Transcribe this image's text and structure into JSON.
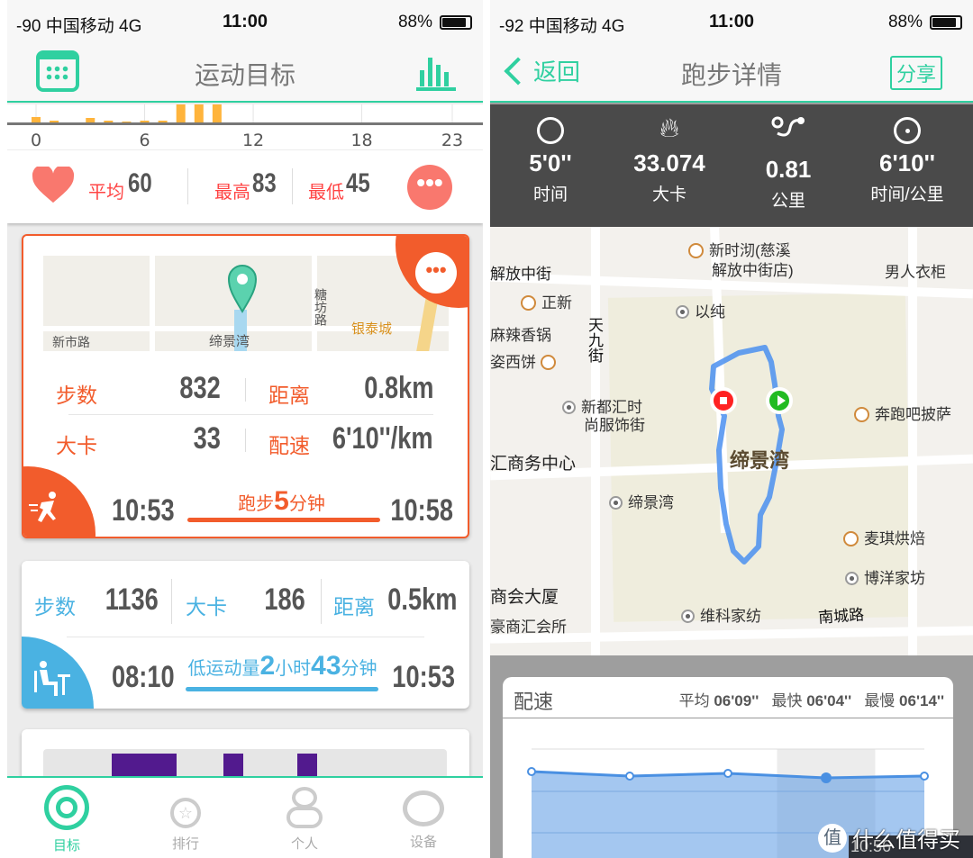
{
  "left": {
    "status": {
      "carrier": "-90 中国移动   4G",
      "time": "11:00",
      "battery": "88%",
      "battery_level": 0.88
    },
    "header": {
      "title": "运动目标",
      "left_icon": "calendar-icon",
      "right_icon": "bar-chart-icon"
    },
    "hourly_chart": {
      "type": "bar",
      "x_ticks": [
        "0",
        "6",
        "12",
        "18",
        "23"
      ],
      "hours": [
        0,
        1,
        3,
        4,
        5,
        6,
        7,
        8,
        9,
        10
      ],
      "values": [
        6,
        2,
        5,
        2,
        1,
        2,
        2,
        20,
        20,
        20
      ],
      "bar_color": "#ffb43c"
    },
    "heart": {
      "avg_label": "平均",
      "avg": "60",
      "max_label": "最高",
      "max": "83",
      "min_label": "最低",
      "min": "45",
      "color": "#f9786e"
    },
    "run_card": {
      "map_labels": {
        "road1": "新市路",
        "road2": "糖坊路",
        "place": "缔景湾",
        "mall": "银泰城"
      },
      "steps_label": "步数",
      "steps": "832",
      "distance_label": "距离",
      "distance": "0.8km",
      "cal_label": "大卡",
      "cal": "33",
      "pace_label": "配速",
      "pace": "6'10''/km",
      "start": "10:53",
      "end": "10:58",
      "activity_prefix": "跑步",
      "activity_value": "5",
      "activity_unit": "分钟",
      "accent": "#f25c2c"
    },
    "sit_card": {
      "steps_label": "步数",
      "steps": "1136",
      "cal_label": "大卡",
      "cal": "186",
      "distance_label": "距离",
      "distance": "0.5km",
      "start": "08:10",
      "end": "10:53",
      "activity_prefix": "低运动量",
      "hours": "2",
      "hours_unit": "小时",
      "minutes": "43",
      "minutes_unit": "分钟",
      "accent": "#4ab2e2"
    },
    "tabs": [
      {
        "label": "目标",
        "icon": "target-icon",
        "active": true
      },
      {
        "label": "排行",
        "icon": "medal-icon",
        "active": false
      },
      {
        "label": "个人",
        "icon": "person-icon",
        "active": false
      },
      {
        "label": "设备",
        "icon": "device-icon",
        "active": false
      }
    ]
  },
  "right": {
    "status": {
      "carrier": "-92 中国移动   4G",
      "time": "11:00",
      "battery": "88%",
      "battery_level": 0.88
    },
    "header": {
      "back": "返回",
      "title": "跑步详情",
      "share": "分享"
    },
    "stats": [
      {
        "value": "5'0''",
        "label": "时间",
        "icon": "stopwatch-icon"
      },
      {
        "value": "33.074",
        "label": "大卡",
        "icon": "flame-icon"
      },
      {
        "value": "0.81",
        "label": "公里",
        "icon": "route-icon"
      },
      {
        "value": "6'10''",
        "label": "时间/公里",
        "icon": "speedometer-icon"
      }
    ],
    "map_labels": [
      "新时沏(慈溪",
      "解放中街店)",
      "解放中街",
      "男人衣柜",
      "正新",
      "以纯",
      "麻辣香锅",
      "姿西饼",
      "天九街",
      "新都汇时",
      "尚服饰街",
      "奔跑吧披萨",
      "汇商务中心",
      "缔景湾",
      "缔景湾",
      "麦琪烘焙",
      "博洋家坊",
      "商会大厦",
      "豪商汇会所",
      "维科家纺",
      "南城路"
    ],
    "pace_card": {
      "title": "配速",
      "avg_label": "平均",
      "avg": "06'09''",
      "fast_label": "最快",
      "fast": "06'04''",
      "slow_label": "最慢",
      "slow": "06'14''"
    },
    "watermark": "什么值得买",
    "watermark_logo": "值",
    "tooltip_time": "10:56"
  },
  "chart_data": {
    "type": "area",
    "title": "配速",
    "x": [
      1,
      2,
      3,
      4,
      5
    ],
    "values_seconds_per_km": [
      364,
      369,
      366,
      371,
      369
    ],
    "highlighted_index": 3,
    "color": "#4a90e2"
  }
}
